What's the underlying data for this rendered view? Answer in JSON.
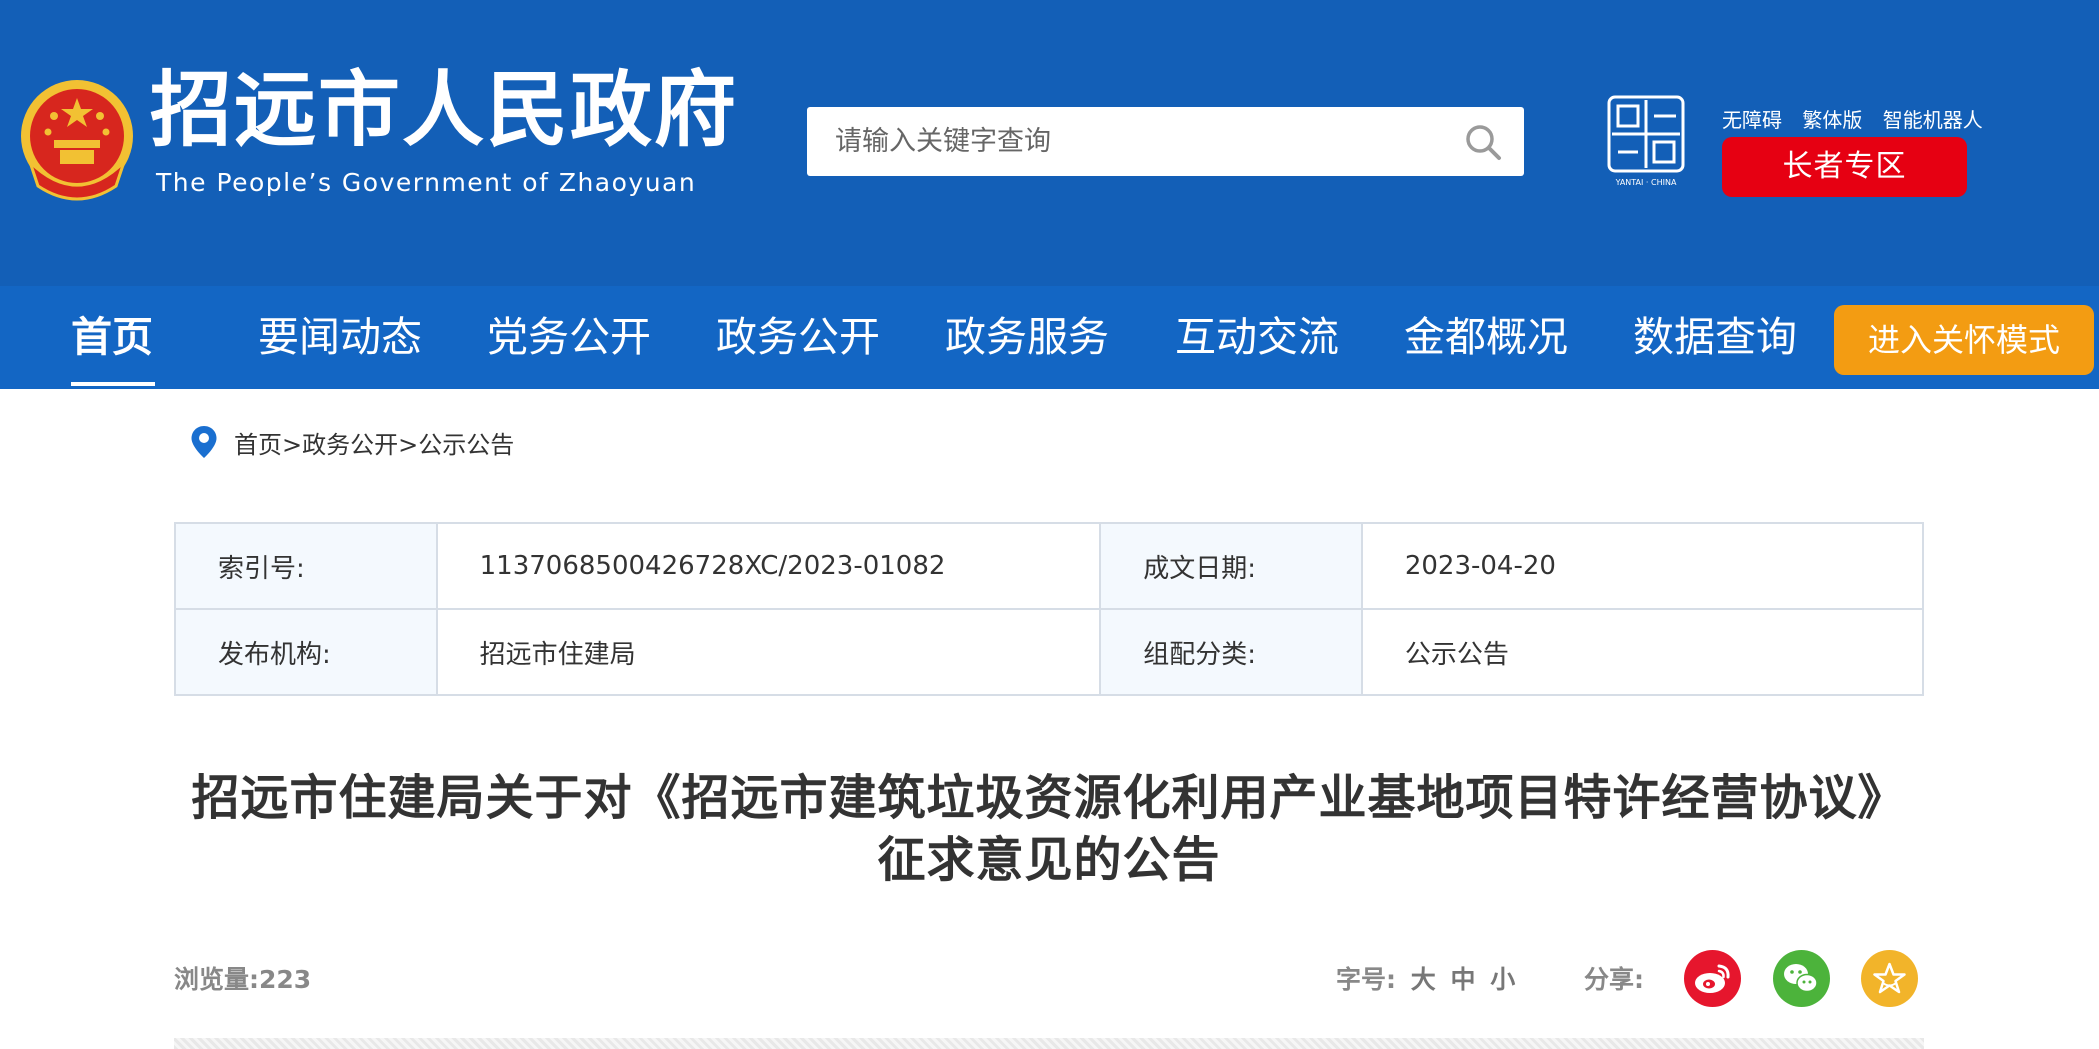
{
  "header": {
    "site_title": "招远市人民政府",
    "site_subtitle": "The People’s Government of Zhaoyuan",
    "search_placeholder": "请输入关键字查询",
    "seal_text_top": "YANTAI · CHINA",
    "top_links": [
      "无障碍",
      "繁体版",
      "智能机器人"
    ],
    "elder_button": "长者专区"
  },
  "nav": {
    "items": [
      "首页",
      "要闻动态",
      "党务公开",
      "政务公开",
      "政务服务",
      "互动交流",
      "金都概况",
      "数据查询"
    ],
    "active_index": 0,
    "care_button": "进入关怀模式"
  },
  "breadcrumb": {
    "items": [
      "首页",
      "政务公开",
      "公示公告"
    ],
    "separator": ">"
  },
  "info": {
    "index_label": "索引号:",
    "index_value": "1137068500426728XC/2023-01082",
    "date_label": "成文日期:",
    "date_value": "2023-04-20",
    "publisher_label": "发布机构:",
    "publisher_value": "招远市住建局",
    "category_label": "组配分类:",
    "category_value": "公示公告"
  },
  "article": {
    "title_line1": "招远市住建局关于对《招远市建筑垃圾资源化利用产业基地项目特许经营协议》",
    "title_line2": "征求意见的公告"
  },
  "meta": {
    "views": "浏览量:223",
    "font_size_label": "字号:",
    "font_sizes": [
      "大",
      "中",
      "小"
    ],
    "share_label": "分享:"
  },
  "colors": {
    "header_bg": "#135fb7",
    "nav_bg": "#1366c4",
    "elder_red": "#e60012",
    "care_orange": "#f39c12",
    "weibo_red": "#e6162d",
    "wechat_green": "#4cb33b",
    "fav_yellow": "#f2b42a"
  },
  "icons": [
    "national-emblem-icon",
    "search-icon",
    "yantai-seal-icon",
    "location-pin-icon",
    "weibo-icon",
    "wechat-icon",
    "favorite-star-icon"
  ]
}
